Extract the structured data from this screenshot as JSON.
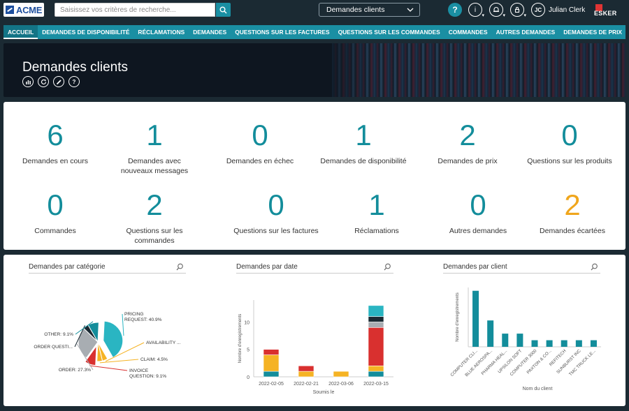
{
  "topbar": {
    "logo_text": "ACME",
    "search_placeholder": "Saisissez vos critères de recherche...",
    "view_selector": "Demandes clients",
    "help": "?",
    "user_initials": "JC",
    "user_name": "Julian Clerk",
    "brand": "ESKER"
  },
  "nav": {
    "items": [
      "ACCUEIL",
      "DEMANDES DE DISPONIBILITÉ",
      "RÉCLAMATIONS",
      "DEMANDES",
      "QUESTIONS SUR LES FACTURES",
      "QUESTIONS SUR LES COMMANDES",
      "COMMANDES",
      "AUTRES DEMANDES",
      "DEMANDES DE PRIX"
    ],
    "more": "▼"
  },
  "banner": {
    "title": "Demandes clients"
  },
  "kpis": [
    {
      "value": "6",
      "label": "Demandes en cours"
    },
    {
      "value": "1",
      "label": "Demandes avec nouveaux messages"
    },
    {
      "value": "0",
      "label": "Demandes en échec"
    },
    {
      "value": "1",
      "label": "Demandes de disponibilité"
    },
    {
      "value": "2",
      "label": "Demandes de prix"
    },
    {
      "value": "0",
      "label": "Questions sur les produits"
    },
    {
      "value": "0",
      "label": "Commandes"
    },
    {
      "value": "2",
      "label": "Questions sur les commandes"
    },
    {
      "value": "0",
      "label": "Questions sur les factures"
    },
    {
      "value": "1",
      "label": "Réclamations"
    },
    {
      "value": "0",
      "label": "Autres demandes"
    },
    {
      "value": "2",
      "label": "Demandes écartées"
    }
  ],
  "colors": {
    "teal": "#1a8fa3",
    "kpi": "#138d9b",
    "warn": "#f0a61c",
    "red": "#d9302f",
    "yellow": "#f5b324",
    "navy": "#1b2a33",
    "gray": "#a8adb2"
  },
  "chart_data": [
    {
      "type": "pie",
      "title": "Demandes par catégorie",
      "slices": [
        {
          "label": "PRICING REQUEST: 40.9%",
          "value": 40.9,
          "color": "#2ab5c2"
        },
        {
          "label": "AVAILABILITY ...",
          "value": 4.5,
          "color": "#f5b324"
        },
        {
          "label": "CLAIM: 4.5%",
          "value": 4.5,
          "color": "#f5b324"
        },
        {
          "label": "INVOICE QUESTION: 9.1%",
          "value": 9.1,
          "color": "#d9302f"
        },
        {
          "label": "ORDER: 27.3%",
          "value": 27.3,
          "color": "#a8adb2"
        },
        {
          "label": "ORDER QUESTI...",
          "value": 4.5,
          "color": "#1b2a33"
        },
        {
          "label": "OTHER: 9.1%",
          "value": 9.1,
          "color": "#138d9b"
        }
      ]
    },
    {
      "type": "bar",
      "title": "Demandes par date",
      "xlabel": "Soumis le",
      "ylabel": "Nombre d'enregistrements",
      "ylim": [
        0,
        14
      ],
      "yticks": [
        "0",
        "5",
        "10"
      ],
      "categories": [
        "2022-02-05",
        "2022-02-21",
        "2022-03-06",
        "2022-03-15"
      ],
      "series": [
        {
          "values": [
            1,
            0,
            0,
            1
          ],
          "color": "#138d9b"
        },
        {
          "values": [
            3,
            1,
            1,
            1
          ],
          "color": "#f5b324"
        },
        {
          "values": [
            1,
            1,
            0,
            7
          ],
          "color": "#d9302f"
        },
        {
          "values": [
            0,
            0,
            0,
            1
          ],
          "color": "#a8adb2"
        },
        {
          "values": [
            0,
            0,
            0,
            1
          ],
          "color": "#1b2a33"
        },
        {
          "values": [
            0,
            0,
            0,
            2
          ],
          "color": "#2ab5c2"
        }
      ]
    },
    {
      "type": "bar",
      "title": "Demandes par client",
      "xlabel": "Nom du client",
      "ylabel": "Nombre d'enregistrements",
      "ylim": [
        0,
        9
      ],
      "categories": [
        "COMPUTER CLI...",
        "BLUE AEROSPA...",
        "PHARMA HEAL...",
        "UPSILON SOFT",
        "COMPUTER 3000",
        "PAXTON & CO...",
        "REFITECH",
        "SUNBURST INC",
        "TMC TRUCK LE..."
      ],
      "values": [
        8.5,
        4,
        2,
        2,
        1,
        1,
        1,
        1,
        1
      ]
    }
  ]
}
